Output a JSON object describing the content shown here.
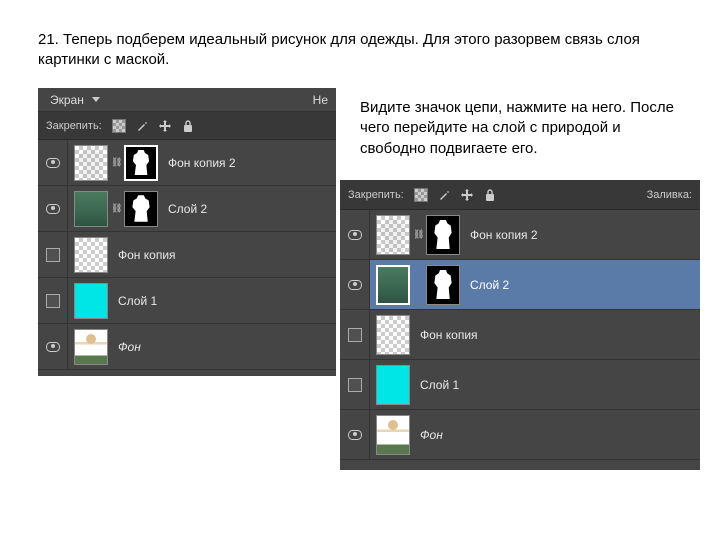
{
  "instruction_main": "21. Теперь подберем идеальный рисунок для одежды. Для этого разорвем связь слоя картинки с маской.",
  "instruction_side": "Видите значок цепи, нажмите на него. После чего перейдите на слой с природой и свободно подвигаете его.",
  "panel1": {
    "blend_mode": "Экран",
    "opacity_hint": "Не",
    "lock_label": "Закрепить:",
    "layers": [
      {
        "name": "Фон копия 2"
      },
      {
        "name": "Слой 2"
      },
      {
        "name": "Фон копия"
      },
      {
        "name": "Слой 1"
      },
      {
        "name": "Фон"
      }
    ]
  },
  "panel2": {
    "lock_label": "Закрепить:",
    "fill_label": "Заливка:",
    "layers": [
      {
        "name": "Фон копия 2"
      },
      {
        "name": "Слой 2"
      },
      {
        "name": "Фон копия"
      },
      {
        "name": "Слой 1"
      },
      {
        "name": "Фон"
      }
    ]
  }
}
